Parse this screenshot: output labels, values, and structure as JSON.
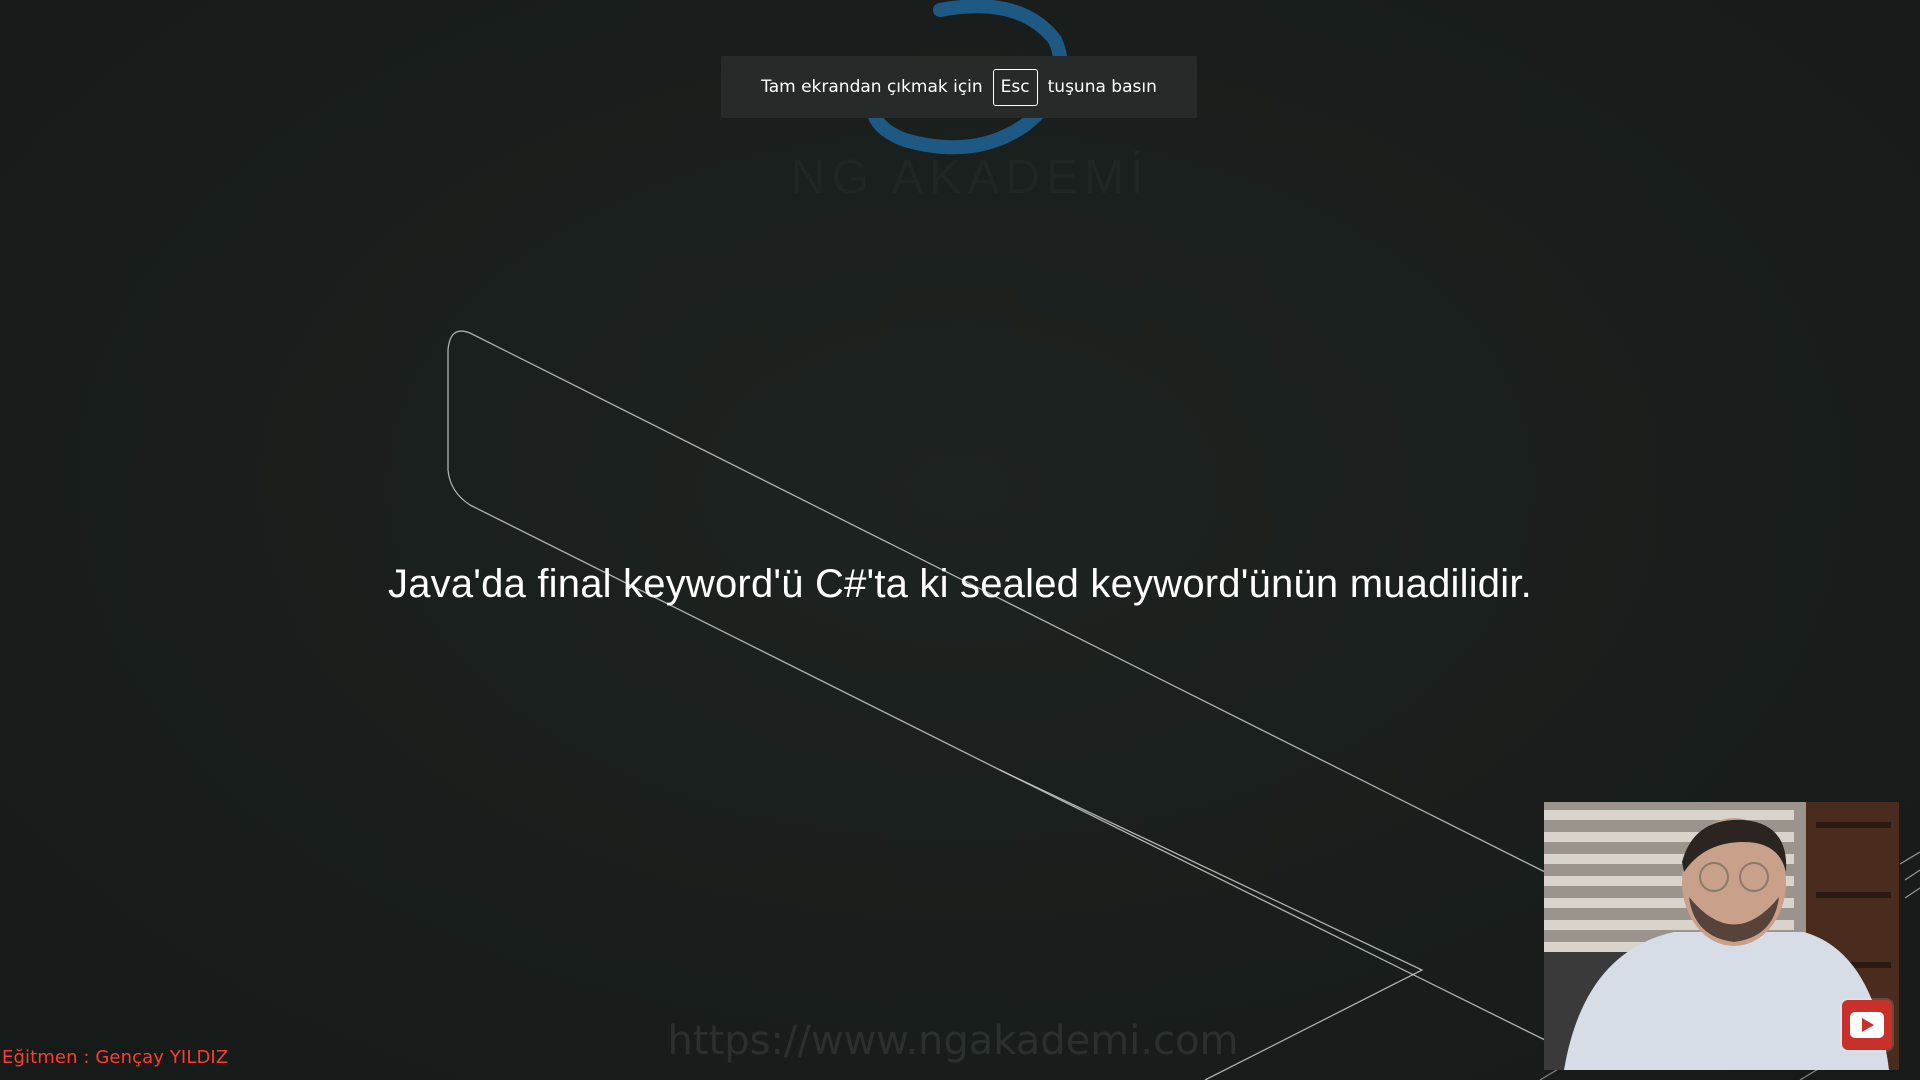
{
  "fullscreen_notice": {
    "prefix": "Tam ekrandan çıkmak için",
    "key": "Esc",
    "suffix": "tuşuna basın"
  },
  "slide": {
    "subtitle": "Java'da final keyword'ü C#'ta ki sealed keyword'ünün muadilidir.",
    "brand_watermark": "NG AKADEMİ",
    "url_watermark": "https://www.ngakademi.com"
  },
  "overlay": {
    "instructor_label": "Eğitmen : Gençay YILDIZ"
  },
  "icons": {
    "logo": "ngakademi-logo-icon",
    "play": "youtube-play-icon"
  },
  "colors": {
    "background": "#1a1f1d",
    "subtitle_text": "#ffffff",
    "instructor_text": "#ff3b30",
    "logo_arc": "#1f5f8f",
    "toast_bg": "#262b2a"
  }
}
